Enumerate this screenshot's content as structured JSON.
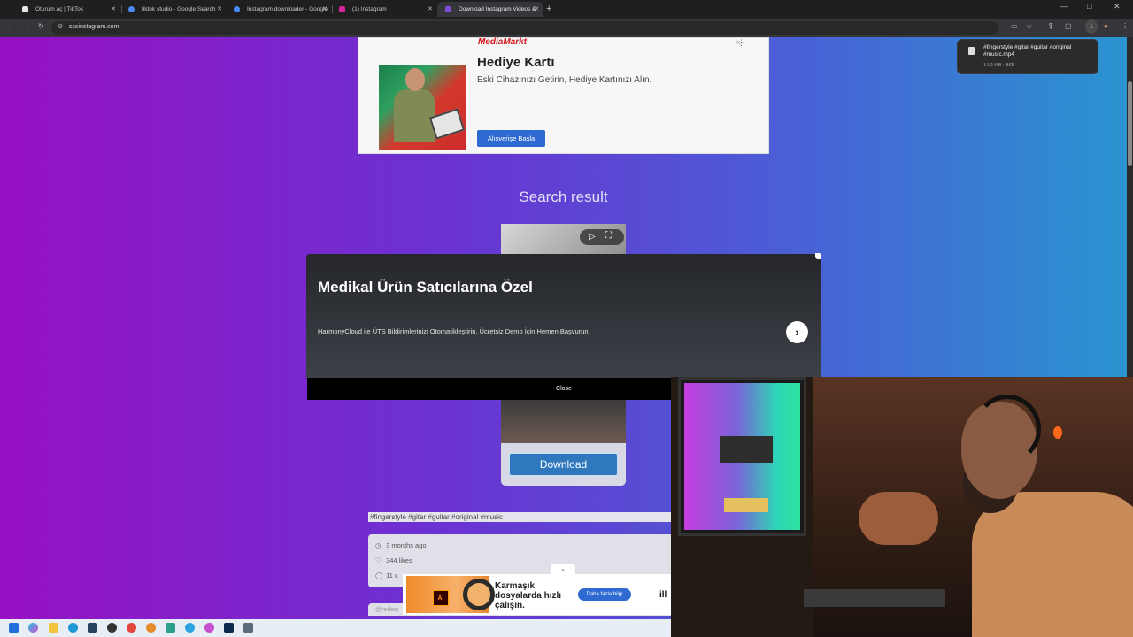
{
  "browser": {
    "tabs": [
      {
        "title": "Oturum aç | TikTok",
        "icon": "tiktok-icon",
        "color": "#e5e5e5"
      },
      {
        "title": "tiktok studio - Google Search",
        "icon": "google-icon",
        "color": "#4a8af4"
      },
      {
        "title": "Instagram downloader - Google",
        "icon": "google-icon",
        "color": "#4a8af4"
      },
      {
        "title": "(1) Instagram",
        "icon": "instagram-icon",
        "color": "#d6249f"
      },
      {
        "title": "Download Instagram Videos &",
        "icon": "site-icon",
        "color": "#7b4dd8"
      }
    ],
    "active_tab": 4,
    "url": "sssinstagram.com"
  },
  "download_popup": {
    "filename": "#fingerstyle #gitar #guitar #original #music.mp4",
    "size": "14,0 MB • 8€5"
  },
  "top_ad": {
    "brand": "MediaMarkt",
    "title": "Hediye Kartı",
    "subtitle": "Eski Cihazınızı Getirin, Hediye Kartınızı Alın.",
    "cta": "Alışverişe Başla"
  },
  "search": {
    "title": "Search result"
  },
  "modal_ad": {
    "heading": "Medikal Ürün Satıcılarına Özel",
    "description": "HarmonyCloud ile ÜTS Bildirimlerinizi Otomatikleştirin, Ücretsiz Demo İçin Hemen Başvurun",
    "close_label": "Close"
  },
  "result": {
    "download_label": "Download",
    "caption": "#fingerstyle #gitar #guitar #original #music",
    "posted": "3 months ago",
    "likes": "344 likes",
    "comments": "11 c",
    "author": "@redesi"
  },
  "bottom_ad": {
    "text": "Karmaşık dosyalarda hızlı çalışın.",
    "cta": "Daha fazla bilgi",
    "brand": "ill",
    "app_label": "Ai"
  }
}
